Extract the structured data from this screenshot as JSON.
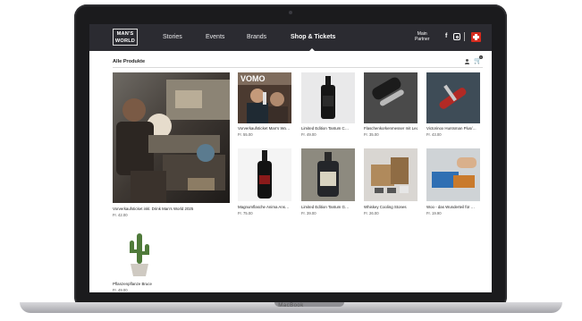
{
  "nav": {
    "logo_line1": "MAN'S",
    "logo_line2": "WORLD",
    "items": [
      "Stories",
      "Events",
      "Brands",
      "Shop & Tickets"
    ],
    "partner_line1": "Main",
    "partner_line2": "Partner",
    "facebook_glyph": "f"
  },
  "shop": {
    "breadcrumb": "Alle Produkte",
    "cart_count": "1"
  },
  "laptop": {
    "brand": "MacBook"
  },
  "products": [
    {
      "name": "Vorverkaufsticket Man's Wo…",
      "price": "Fr. 55.00",
      "image": "bar-scene-photo"
    },
    {
      "name": "Limited Edition Tantum C…",
      "price": "Fr. 49.00",
      "image": "dark-bottle-on-white"
    },
    {
      "name": "Flaschenkorkenmesser mit Led…",
      "price": "Fr. 35.00",
      "image": "leather-knife-case"
    },
    {
      "name": "Victorinox Huntsman Plus/…",
      "price": "Fr. 43.00",
      "image": "red-pocket-knife"
    },
    {
      "name": "Vorverkaufsticket inkl. Drink Man's World 2025",
      "price": "Fr. 42.00",
      "image": "bartender-photo"
    },
    {
      "name": "Magnumflasche Anima Ans…",
      "price": "Fr. 75.00",
      "image": "magnum-bottle"
    },
    {
      "name": "Limited Edition Tantum G…",
      "price": "Fr. 39.00",
      "image": "labeled-bottle"
    },
    {
      "name": "Whiskey Cooling Stones",
      "price": "Fr. 26.00",
      "image": "cooling-stones-box"
    },
    {
      "name": "Woo - das Wunderteil für …",
      "price": "Fr. 19.90",
      "image": "blue-box-gadget"
    },
    {
      "name": "Pflanzenpflanze Bruce",
      "price": "Fr. 49.00",
      "image": "potted-cactus"
    }
  ]
}
